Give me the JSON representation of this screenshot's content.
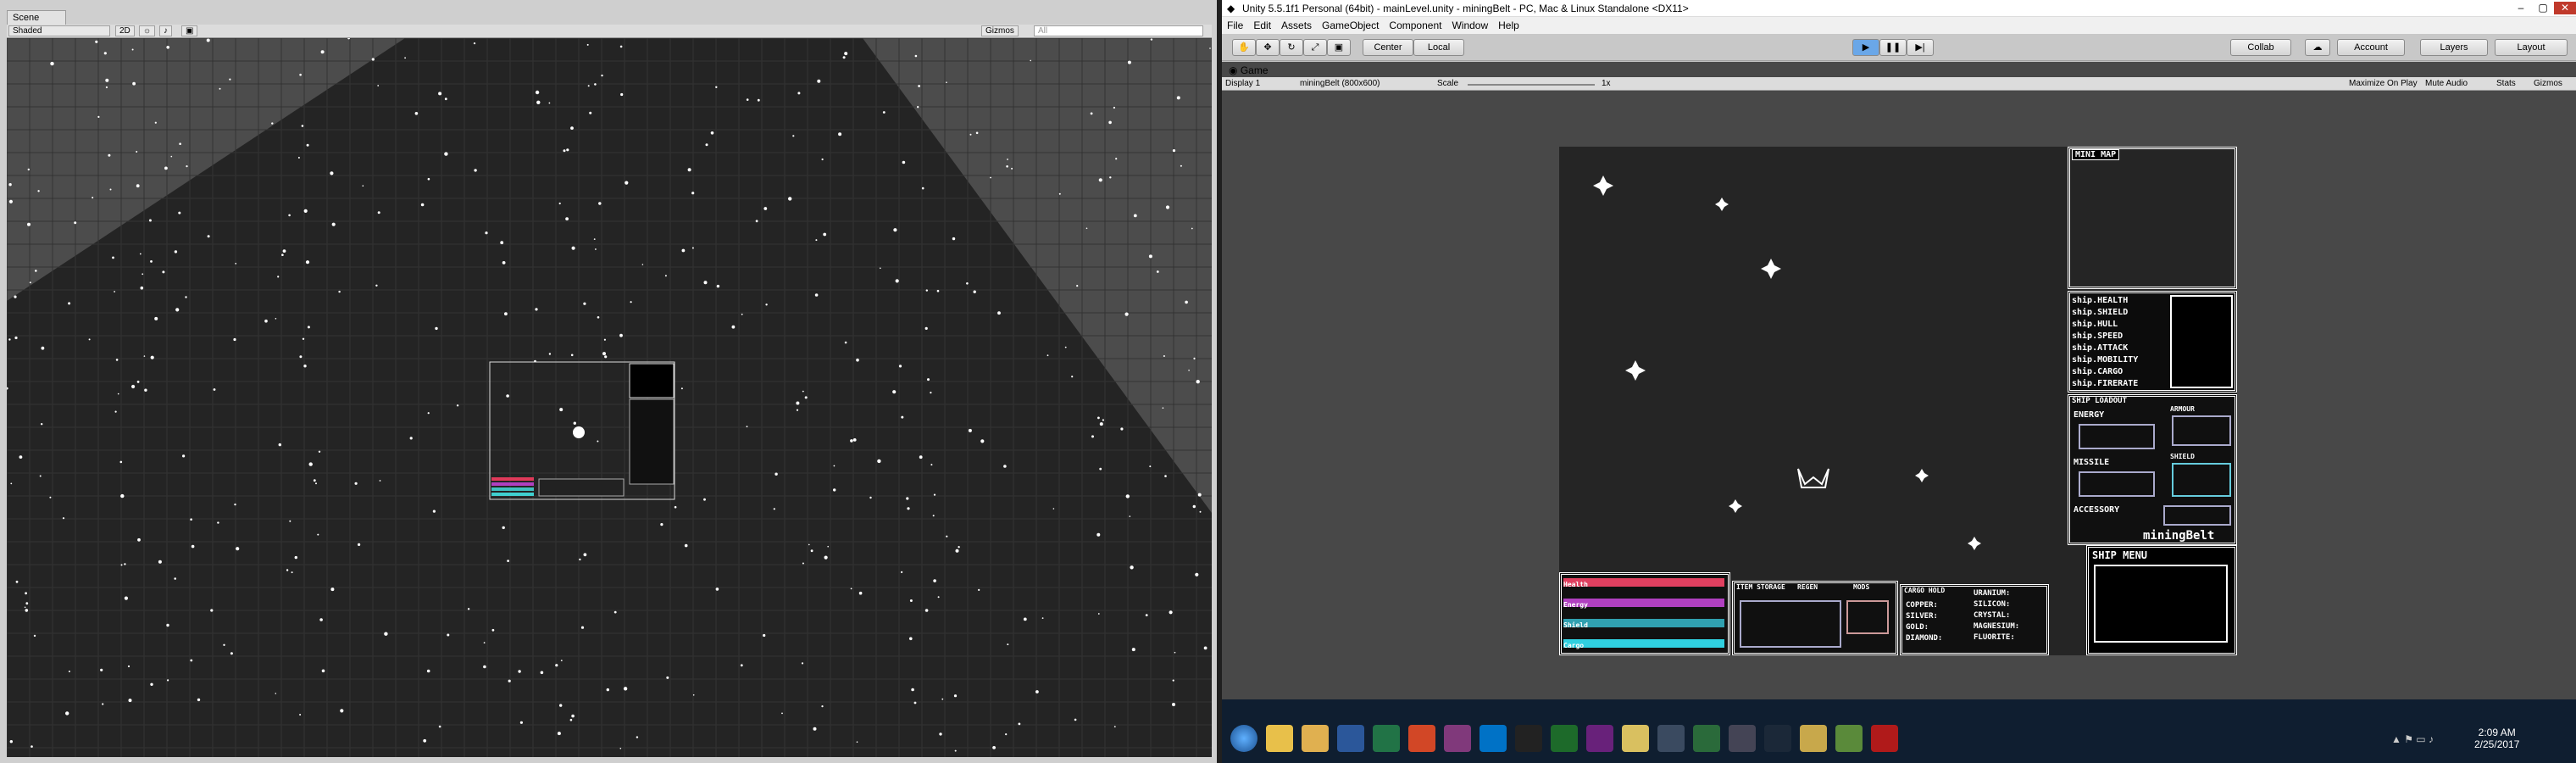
{
  "scene": {
    "tab": "Scene",
    "shading": "Shaded",
    "mode_2d": "2D",
    "gizmos": "Gizmos",
    "search_placeholder": "All"
  },
  "title": "Unity 5.5.1f1 Personal (64bit) - mainLevel.unity - miningBelt - PC, Mac & Linux Standalone <DX11>",
  "menu": [
    "File",
    "Edit",
    "Assets",
    "GameObject",
    "Component",
    "Window",
    "Help"
  ],
  "toolbar": {
    "center": "Center",
    "local": "Local",
    "collab": "Collab",
    "account": "Account",
    "layers": "Layers",
    "layout": "Layout"
  },
  "game": {
    "tab": "Game",
    "display": "Display 1",
    "resolution": "miningBelt (800x600)",
    "scale_label": "Scale",
    "scale_value": "1x",
    "maximize": "Maximize On Play",
    "mute": "Mute Audio",
    "stats": "Stats",
    "gizmos": "Gizmos"
  },
  "hud": {
    "minimap": "MINI MAP",
    "stats": [
      "ship.HEALTH",
      "ship.SHIELD",
      "ship.HULL",
      "ship.SPEED",
      "ship.ATTACK",
      "ship.MOBILITY",
      "ship.CARGO",
      "ship.FIRERATE"
    ],
    "loadout": "SHIP LOADOUT",
    "energy": "ENERGY",
    "missile": "MISSILE",
    "armour": "ARMOUR",
    "shield": "SHIELD",
    "accessory": "ACCESSORY",
    "title": "miningBelt",
    "ship_menu": "SHIP MENU",
    "bars": [
      "Health",
      "Energy",
      "Shield",
      "Cargo"
    ],
    "item_storage": "ITEM STORAGE",
    "regen": "REGEN",
    "mods": "MODS",
    "cargo_hold": "CARGO HOLD",
    "ores_left": [
      "COPPER:",
      "SILVER:",
      "GOLD:",
      "DIAMOND:"
    ],
    "ores_right": [
      "URANIUM:",
      "SILICON:",
      "CRYSTAL:",
      "MAGNESIUM:",
      "FLUORITE:"
    ]
  },
  "clock": {
    "time": "2:09 AM",
    "date": "2/25/2017"
  }
}
